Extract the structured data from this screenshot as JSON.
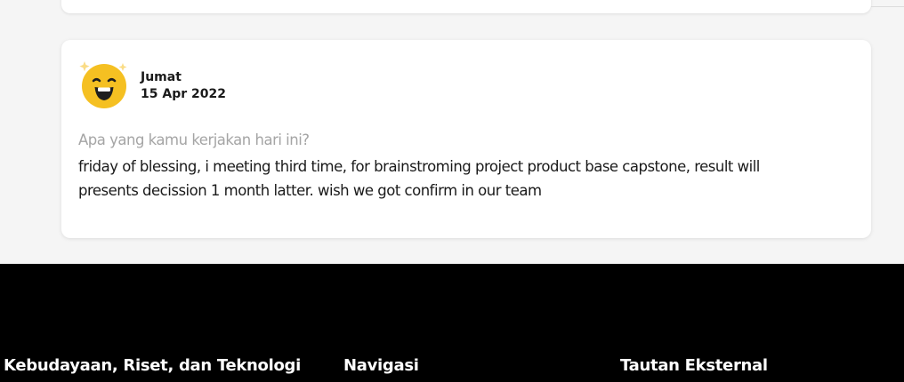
{
  "entry": {
    "day": "Jumat",
    "date": "15 Apr 2022",
    "avatar_icon": "happy-star-face-icon",
    "question": "Apa yang kamu kerjakan hari ini?",
    "answer": "friday of blessing, i  meeting third time, for brainstroming project product base capstone, result will presents decission 1 month latter. wish we got confirm in our team"
  },
  "footer": {
    "col1_heading": ", Kebudayaan, Riset, dan Teknologi",
    "col2_heading": "Navigasi",
    "col3_heading": "Tautan Eksternal"
  },
  "colors": {
    "page_bg": "#f5f5f5",
    "card_bg": "#ffffff",
    "question_text": "#a5a5a5",
    "body_text": "#1a1a1a",
    "footer_bg": "#000000",
    "avatar_yellow": "#f5c022"
  }
}
